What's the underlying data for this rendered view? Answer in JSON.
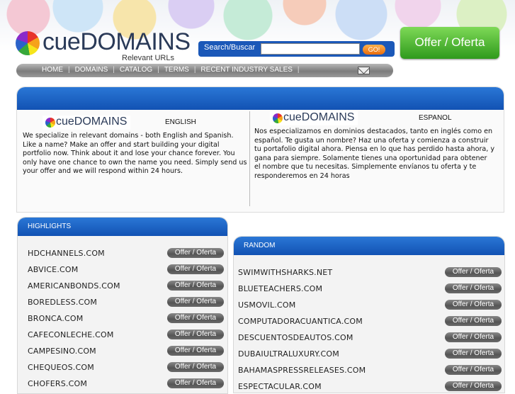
{
  "header": {
    "logo_cue": "cue",
    "logo_domains": "DOMAINS",
    "logo_tagline": "Relevant URLs"
  },
  "search": {
    "label": "Search/Buscar",
    "value": "",
    "go_label": "GO!"
  },
  "offer_button_label": "Offer / Oferta",
  "nav": {
    "items": [
      "HOME",
      "DOMAINS",
      "CATALOG",
      "TERMS",
      "RECENT INDUSTRY SALES"
    ],
    "separator": "|",
    "mail_icon": "envelope-icon"
  },
  "intro": {
    "english": {
      "logo_cue": "cue",
      "logo_domains": "DOMAINS",
      "label": "ENGLISH",
      "text": "We specialize in relevant domains - both English and Spanish. Like a name? Make an offer and start building your digital portfolio now. Think about it and lose your chance forever. You only have one chance to own the name you need. Simply send us your offer and we will respond within 24 hours."
    },
    "spanish": {
      "logo_cue": "cue",
      "logo_domains": "DOMAINS",
      "label": "ESPANOL",
      "text": "Nos especializamos en dominios destacados, tanto en inglés como en español. Te gusta un nombre? Haz una oferta y comienza a construir tu portafolio digital ahora. Piensa en lo que has perdido hasta ahora, y gana para siempre. Solamente tienes una oportunidad para obtener el nombre que tu necesitas. Simplemente envíanos tu oferta y te responderemos en 24 horas"
    }
  },
  "highlights": {
    "title": "HIGHLIGHTS",
    "offer_label": "Offer / Oferta",
    "items": [
      "HDCHANNELS.COM",
      "ABVICE.COM",
      "AMERICANBONDS.COM",
      "BOREDLESS.COM",
      "BRONCA.COM",
      "CAFECONLECHE.COM",
      "CAMPESINO.COM",
      "CHEQUEOS.COM",
      "CHOFERS.COM"
    ]
  },
  "random": {
    "title": "RANDOM",
    "offer_label": "Offer / Oferta",
    "items": [
      "SWIMWITHSHARKS.NET",
      "BLUETEACHERS.COM",
      "USMOVIL.COM",
      "COMPUTADORACUANTICA.COM",
      "DESCUENTOSDEAUTOS.COM",
      "DUBAIULTRALUXURY.COM",
      "BAHAMASPRESSRELEASES.COM",
      "ESPECTACULAR.COM"
    ]
  },
  "colors": {
    "header_blue": "#1b58b8",
    "offer_green": "#3fae24",
    "pill_gray": "#666666"
  }
}
